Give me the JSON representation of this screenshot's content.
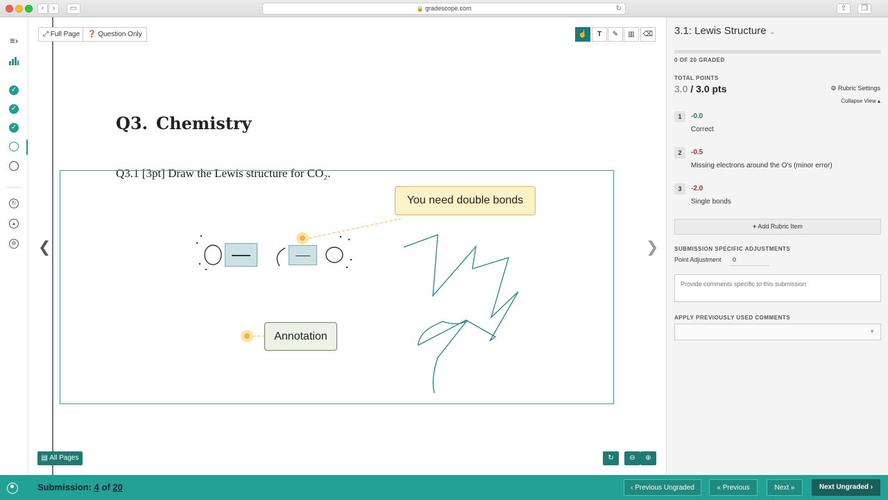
{
  "browser": {
    "url": "gradescope.com",
    "back_icon": "chevron-left",
    "forward_icon": "chevron-right",
    "reload_icon": "reload",
    "sidebar_icon": "sidebar",
    "share_icon": "share",
    "tabs_icon": "tabs"
  },
  "viewer": {
    "full_page_label": "Full Page",
    "question_only_label": "Question Only",
    "tools": [
      "pointer",
      "text",
      "pen",
      "box",
      "eraser"
    ],
    "tool_text_glyph": "T",
    "active_tool": "pointer",
    "question_heading_number": "Q3.",
    "question_heading_title": "Chemistry",
    "question_prompt": "Q3.1 [3pt] Draw the Lewis structure for CO₂.",
    "annotations": [
      {
        "text": "You need double bonds"
      },
      {
        "text": "Annotation"
      }
    ],
    "all_pages_label": "All Pages"
  },
  "panel": {
    "question_title": "3.1: Lewis Structure",
    "graded_status": "0 OF 20 GRADED",
    "graded_progress": 0,
    "total_points_label": "TOTAL POINTS",
    "points_earned": "3.0",
    "points_total": "/ 3.0 pts",
    "rubric_settings_label": "Rubric Settings",
    "collapse_view_label": "Collapse View",
    "rubric_items": [
      {
        "number": "1",
        "points": "-0.0",
        "description": "Correct",
        "color": "#2a7a3a"
      },
      {
        "number": "2",
        "points": "-0.5",
        "description": "Missing electrons around the O's (minor error)",
        "color": "#b12a2a"
      },
      {
        "number": "3",
        "points": "-2.0",
        "description": "Single bonds",
        "color": "#b12a2a"
      }
    ],
    "add_rubric_label": "Add Rubric Item",
    "adjustments_heading": "SUBMISSION SPECIFIC ADJUSTMENTS",
    "point_adjustment_label": "Point Adjustment",
    "point_adjustment_value": "0",
    "comment_placeholder": "Provide comments specific to this submission",
    "previous_comments_heading": "APPLY PREVIOUSLY USED COMMENTS"
  },
  "bottom_bar": {
    "submission_label": "Submission:",
    "submission_current": "4",
    "submission_of": "of",
    "submission_total": "20",
    "previous_ungraded_label": "Previous Ungraded",
    "previous_label": "Previous",
    "next_label": "Next",
    "next_ungraded_label": "Next Ungraded"
  },
  "colors": {
    "accent": "#22a195",
    "dark_accent": "#1f7a74",
    "deduction": "#b12a2a",
    "credit": "#2a7a3a",
    "annotation_yellow": "#fdf1c7"
  }
}
